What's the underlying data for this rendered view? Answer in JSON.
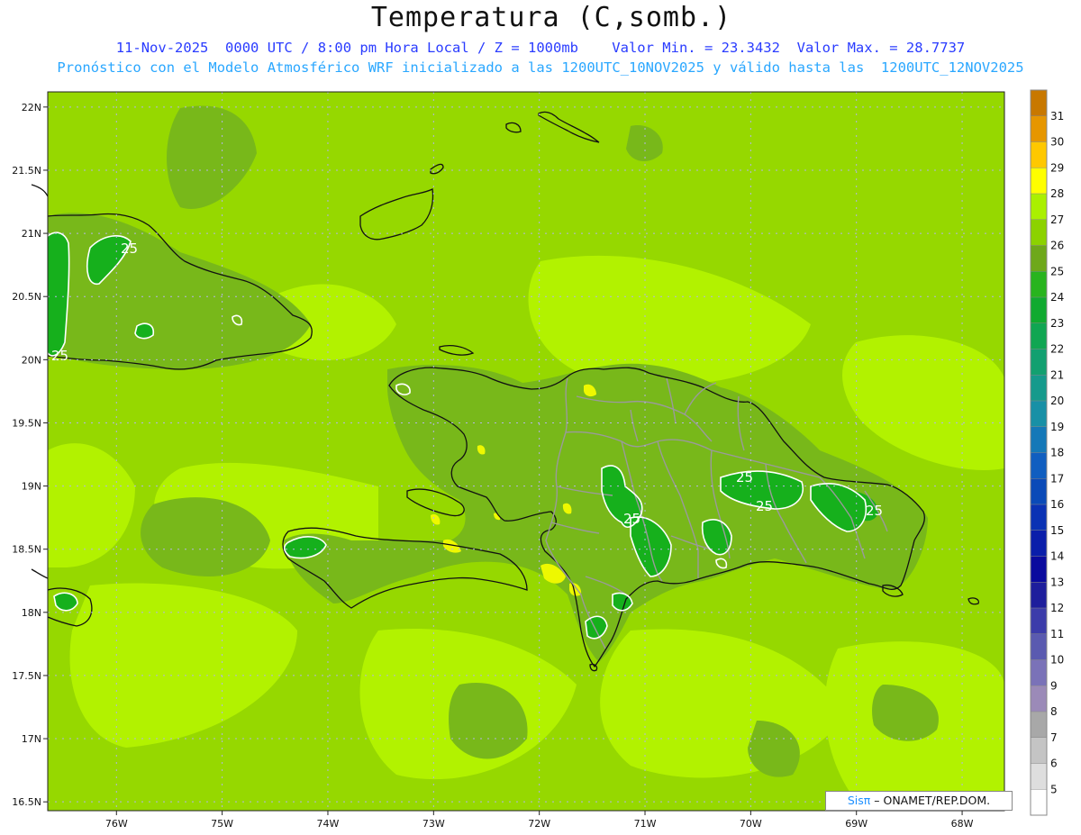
{
  "title": "Temperatura (C,somb.)",
  "subtitle_line1": "11-Nov-2025  0000 UTC / 8:00 pm Hora Local / Z = 1000mb    Valor Min. = 23.3432  Valor Max. = 28.7737",
  "subtitle_line2": "Pronóstico con el Modelo Atmosférico WRF inicializado a las 1200UTC_10NOV2025 y válido hasta las  1200UTC_12NOV2025",
  "credit": {
    "brand": "Sisπ",
    "text": " – ONAMET/REP.DOM."
  },
  "axes": {
    "lat_ticks": [
      "22N",
      "21.5N",
      "21N",
      "20.5N",
      "20N",
      "19.5N",
      "19N",
      "18.5N",
      "18N",
      "17.5N",
      "17N",
      "16.5N"
    ],
    "lon_ticks": [
      "76W",
      "75W",
      "74W",
      "73W",
      "72W",
      "71W",
      "70W",
      "69W",
      "68W"
    ],
    "lat_range": [
      16.43,
      22.12
    ],
    "lon_range": [
      -76.65,
      -67.6
    ]
  },
  "colorbar": {
    "labels": [
      "5",
      "6",
      "7",
      "8",
      "9",
      "10",
      "11",
      "12",
      "13",
      "14",
      "15",
      "16",
      "17",
      "18",
      "19",
      "20",
      "21",
      "22",
      "23",
      "24",
      "25",
      "26",
      "27",
      "28",
      "29",
      "30",
      "31"
    ],
    "colors": [
      "#ffffff",
      "#dedede",
      "#c4c4c4",
      "#a8a8a8",
      "#9b8ab8",
      "#7a72b8",
      "#5a5ab0",
      "#3c3caa",
      "#1e1e9c",
      "#0a0a9e",
      "#0a1eaa",
      "#0a32b4",
      "#0a4ab8",
      "#105ec0",
      "#1478b8",
      "#1890a6",
      "#159a8c",
      "#12a070",
      "#10a652",
      "#10aa30",
      "#28b41e",
      "#6ea81a",
      "#8cd200",
      "#aaf000",
      "#ffff00",
      "#ffc800",
      "#e69600",
      "#c87800"
    ]
  },
  "contour_labels": [
    "25",
    "25",
    "25",
    "25",
    "25",
    "25",
    "25"
  ],
  "colors": {
    "ocean": "#96d800",
    "warm": "#b2f200",
    "cool": "#78b81a",
    "coolest": "#16b01c",
    "hot": "#eef800",
    "grid": "#b4b4e6"
  }
}
